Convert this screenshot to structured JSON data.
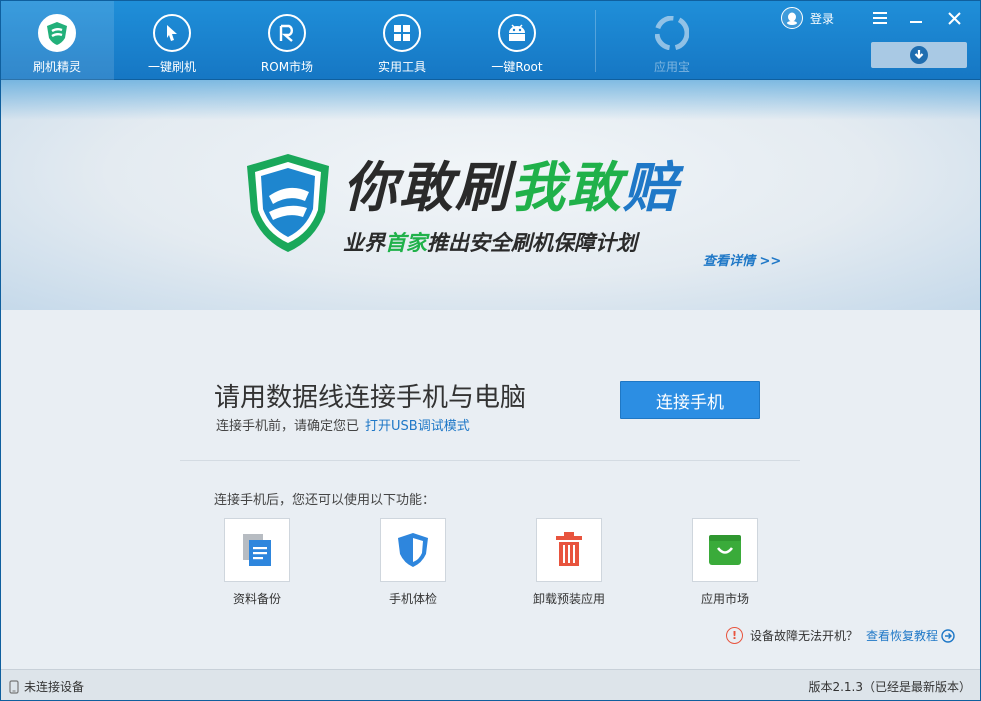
{
  "nav": {
    "items": [
      {
        "label": "刷机精灵",
        "icon": "shield-icon"
      },
      {
        "label": "一键刷机",
        "icon": "cursor-icon"
      },
      {
        "label": "ROM市场",
        "icon": "rom-icon"
      },
      {
        "label": "实用工具",
        "icon": "grid-icon"
      },
      {
        "label": "一键Root",
        "icon": "android-icon"
      },
      {
        "label": "应用宝",
        "icon": "appstore-icon"
      }
    ],
    "login_label": "登录"
  },
  "banner": {
    "slogan_part1": "你敢刷",
    "slogan_part2": "我敢",
    "slogan_part3": "赔",
    "sub_part1": "业界",
    "sub_part2": "首家",
    "sub_part3": "推出安全刷机保障计划",
    "details_link": "查看详情 >>"
  },
  "connect": {
    "title": "请用数据线连接手机与电脑",
    "note": "连接手机前，请确定您已",
    "note_link": "打开USB调试模式",
    "button": "连接手机"
  },
  "features": {
    "intro": "连接手机后，您还可以使用以下功能：",
    "items": [
      {
        "label": "资料备份",
        "icon": "backup-document-icon"
      },
      {
        "label": "手机体检",
        "icon": "shield-check-icon"
      },
      {
        "label": "卸载预装应用",
        "icon": "trash-icon"
      },
      {
        "label": "应用市场",
        "icon": "shopping-bag-icon"
      }
    ]
  },
  "help": {
    "text": "设备故障无法开机？",
    "link": "查看恢复教程"
  },
  "status": {
    "left": "未连接设备",
    "right": "版本2.1.3（已经是最新版本）"
  },
  "colors": {
    "accent": "#1f78c7",
    "topbar": "#1a83cf",
    "green": "#20b14a"
  }
}
